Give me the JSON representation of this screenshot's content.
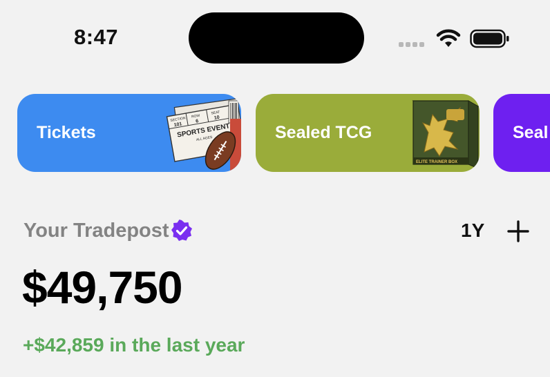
{
  "status_bar": {
    "time": "8:47",
    "icons": [
      "cellular-icon",
      "wifi-icon",
      "battery-icon"
    ]
  },
  "categories": [
    {
      "label": "Tickets",
      "color": "#3d8bf0",
      "art_text": [
        "SECTION",
        "101",
        "ROW",
        "6",
        "SEAT",
        "10",
        "SPORTS EVENT",
        "ALL AGES"
      ]
    },
    {
      "label": "Sealed TCG",
      "color": "#9aac3a",
      "art_text": [
        "ELITE TRAINER BOX"
      ]
    },
    {
      "label": "Seal",
      "color": "#6e20f0"
    }
  ],
  "portfolio": {
    "title": "Your Tradepost",
    "range": "1Y",
    "total": "$49,750",
    "change_amount": "+$42,859",
    "change_suffix": "in the last year",
    "accent_positive": "#5aa95a",
    "verified_color": "#7a2ff0"
  }
}
